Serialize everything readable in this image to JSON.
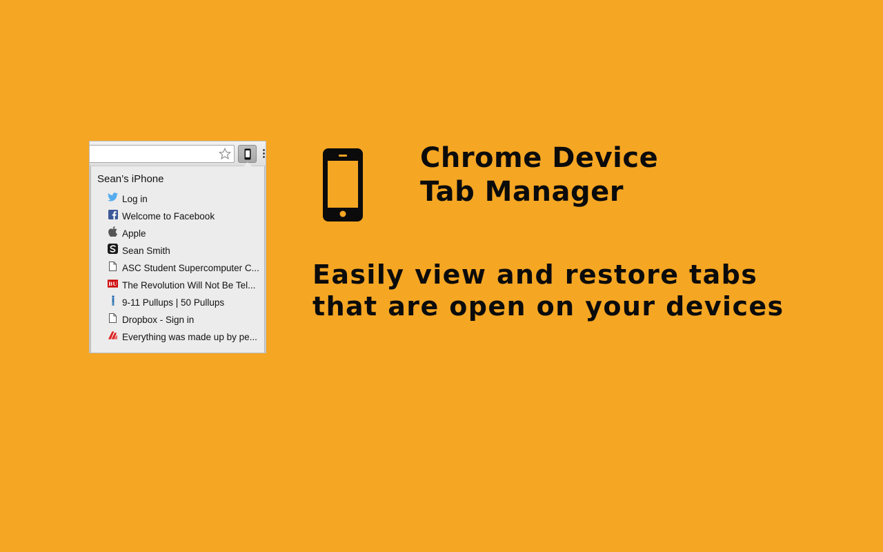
{
  "popup": {
    "device_name": "Sean’s iPhone",
    "tabs": [
      {
        "title": "Log in",
        "icon": "twitter-icon"
      },
      {
        "title": "Welcome to Facebook",
        "icon": "facebook-icon"
      },
      {
        "title": "Apple",
        "icon": "apple-icon"
      },
      {
        "title": "Sean Smith",
        "icon": "s-logo-icon"
      },
      {
        "title": "ASC Student Supercomputer C...",
        "icon": "document-icon"
      },
      {
        "title": "The Revolution Will Not Be Tel...",
        "icon": "bu-icon"
      },
      {
        "title": "9-11 Pullups | 50 Pullups",
        "icon": "figure-icon"
      },
      {
        "title": "Dropbox - Sign in",
        "icon": "document-icon"
      },
      {
        "title": "Everything was made up by pe...",
        "icon": "red-logo-icon"
      }
    ]
  },
  "hero": {
    "title_line1": "Chrome Device",
    "title_line2": "Tab Manager",
    "tagline_line1": "Easily view and restore tabs",
    "tagline_line2": "that are open on your devices"
  },
  "colors": {
    "background": "#F5A623",
    "text": "#0B0B0B",
    "twitter": "#55ACEE",
    "facebook": "#3B5998",
    "bu_red": "#CC0000"
  }
}
